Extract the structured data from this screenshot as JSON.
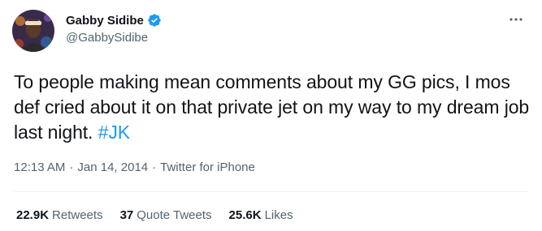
{
  "tweet": {
    "author": {
      "display_name": "Gabby Sidibe",
      "handle": "@GabbySidibe",
      "verified": true
    },
    "text_parts": {
      "body": "To people making mean comments about my GG pics, I mos def cried about it on that private jet on my way to my dream job last night.",
      "hashtag": "#JK"
    },
    "meta": {
      "time": "12:13 AM",
      "separator": "·",
      "date": "Jan 14, 2014",
      "source": "Twitter for iPhone"
    },
    "stats": {
      "retweets": {
        "count": "22.9K",
        "label": "Retweets"
      },
      "quote_tweets": {
        "count": "37",
        "label": "Quote Tweets"
      },
      "likes": {
        "count": "25.6K",
        "label": "Likes"
      }
    }
  },
  "icons": {
    "verified": "verified-badge-icon",
    "more": "more-options-icon"
  },
  "colors": {
    "text": "#0f1419",
    "secondary": "#536471",
    "accent": "#1d9bf0",
    "divider": "#eff3f4"
  }
}
